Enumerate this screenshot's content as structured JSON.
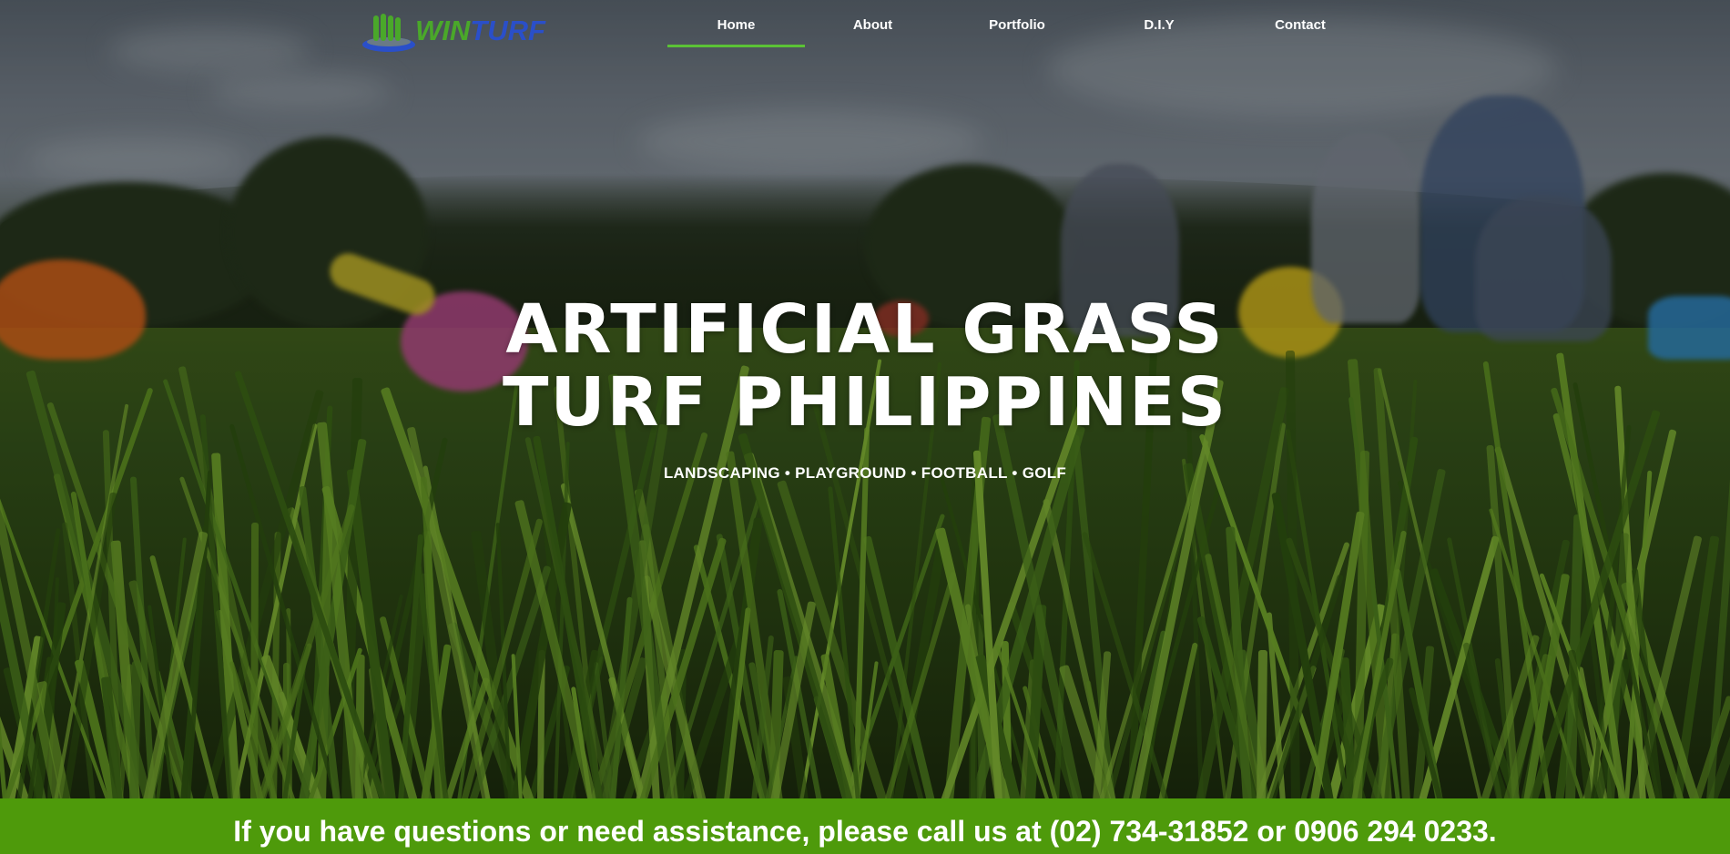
{
  "header": {
    "logo": {
      "text_win": "WIN",
      "text_turf": "TURF",
      "mark_icon": "grass-blades-icon"
    },
    "nav": [
      {
        "label": "Home",
        "active": true
      },
      {
        "label": "About",
        "active": false
      },
      {
        "label": "Portfolio",
        "active": false
      },
      {
        "label": "D.I.Y",
        "active": false
      },
      {
        "label": "Contact",
        "active": false
      }
    ]
  },
  "hero": {
    "title_line1": "ARTIFICIAL GRASS",
    "title_line2": "TURF PHILIPPINES",
    "subtitle": "LANDSCAPING • PLAYGROUND • FOOTBALL • GOLF"
  },
  "cta": {
    "text": "If you have questions or need assistance, please call us at (02) 734-31852 or 0906 294 0233."
  },
  "colors": {
    "accent_green": "#5bc236",
    "cta_green": "#4e9a0b",
    "logo_blue": "#2a4fc9",
    "logo_green": "#4aa82a"
  }
}
